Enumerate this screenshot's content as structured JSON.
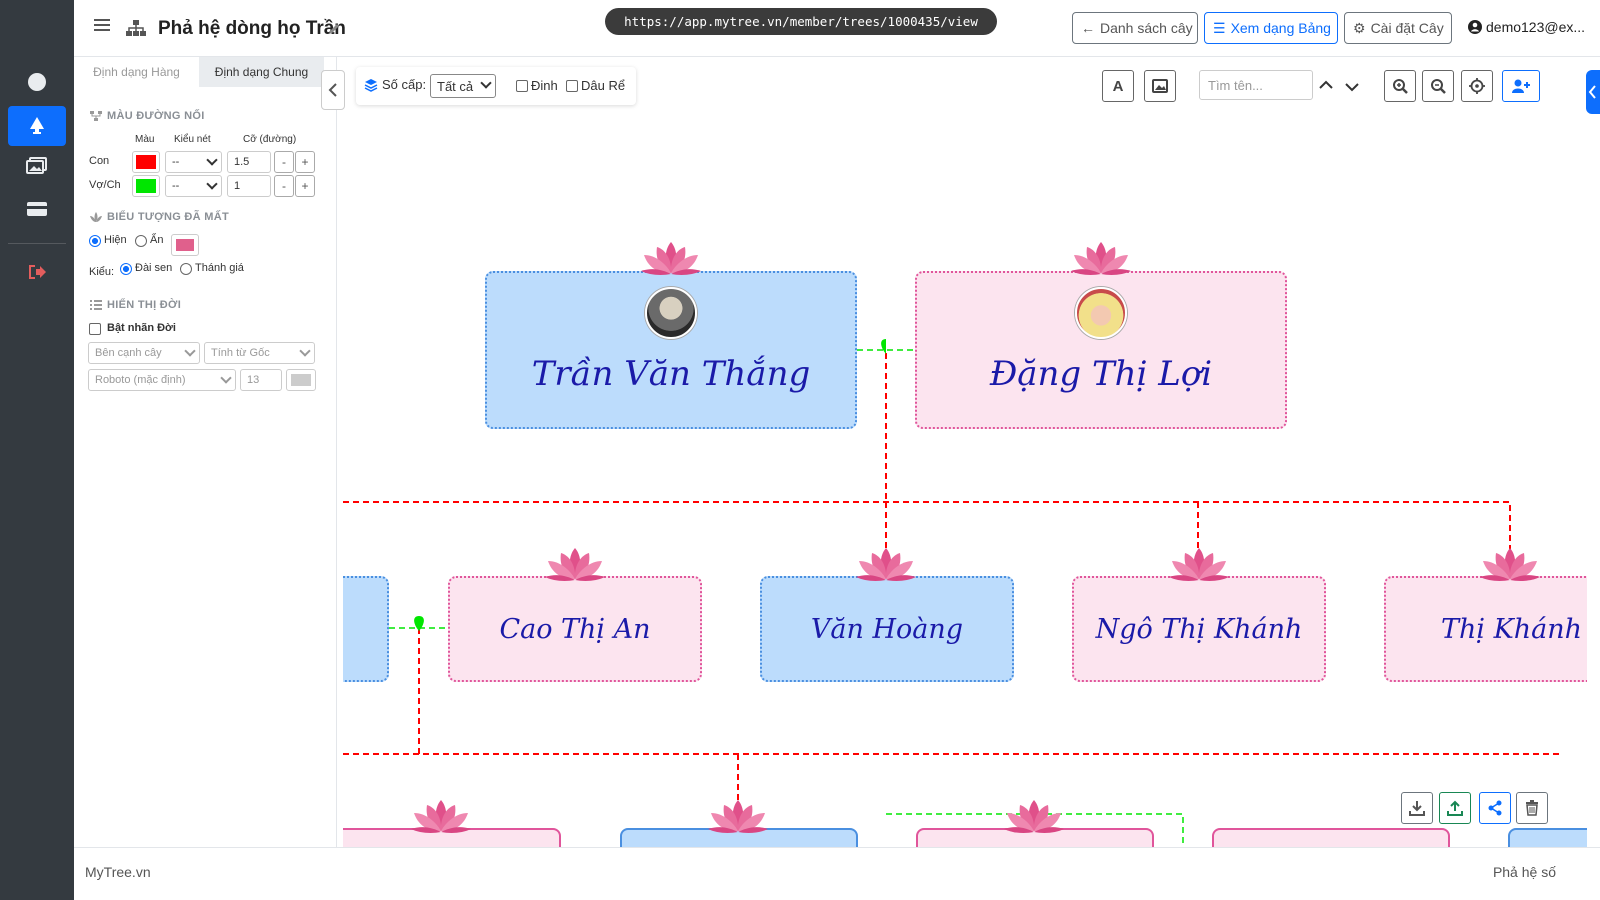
{
  "app": {
    "brand": "MyTree.vn"
  },
  "header": {
    "title": "Phả hệ dòng họ Trần",
    "url": "https://app.mytree.vn/member/trees/1000435/view",
    "btn_list": "Danh sách cây",
    "btn_table": "Xem dạng Bảng",
    "btn_settings": "Cài đặt Cây",
    "user": "demo123@ex..."
  },
  "sidebar": {
    "tabs": [
      "Định dạng Hàng",
      "Định dạng Chung"
    ],
    "line_color": {
      "title": "MÀU ĐƯỜNG NỐI",
      "col_color": "Màu",
      "col_style": "Kiểu nét",
      "col_size": "Cỡ (đường)",
      "rows": [
        {
          "label": "Con",
          "color": "#ff0000",
          "style": "--",
          "size": "1.5"
        },
        {
          "label": "Vợ/Ch",
          "color": "#00e600",
          "style": "--",
          "size": "1"
        }
      ],
      "minus": "-",
      "plus": "+"
    },
    "deceased": {
      "title": "BIỂU TƯỢNG ĐÃ MẤT",
      "show": "Hiện",
      "hide": "Ẩn",
      "color": "#e0608c",
      "kind_label": "Kiểu:",
      "lotus": "Đài sen",
      "altar": "Thánh giá"
    },
    "generation": {
      "title": "HIỂN THỊ ĐỜI",
      "enable": "Bật nhãn Đời",
      "position": "Bên cạnh cây",
      "from": "Tính từ Gốc",
      "font": "Roboto (mặc định)",
      "size": "13"
    }
  },
  "toolbar": {
    "levels_label": "Số cấp:",
    "levels_value": "Tất cả",
    "pin": "Đinh",
    "in_law": "Dâu Rể",
    "search_placeholder": "Tìm tên..."
  },
  "tree": {
    "gen1": [
      {
        "name": "Trần Văn Thắng",
        "gender": "male"
      },
      {
        "name": "Đặng Thị Lợi",
        "gender": "female"
      }
    ],
    "gen2": [
      {
        "name": "Cao Thị An",
        "gender": "female"
      },
      {
        "name": "Văn Hoàng",
        "gender": "male"
      },
      {
        "name": "Ngô Thị Khánh",
        "gender": "female"
      },
      {
        "name": "Thị Khánh T",
        "gender": "female"
      }
    ]
  },
  "footer": {
    "left": "MyTree.vn",
    "right": "Phả hệ số"
  },
  "colors": {
    "primary": "#0d6efd",
    "child_line": "#ff0000",
    "spouse_line": "#00e600",
    "male_bg": "#bcdcfc",
    "female_bg": "#fce4ef",
    "name": "#1a1aa8"
  }
}
